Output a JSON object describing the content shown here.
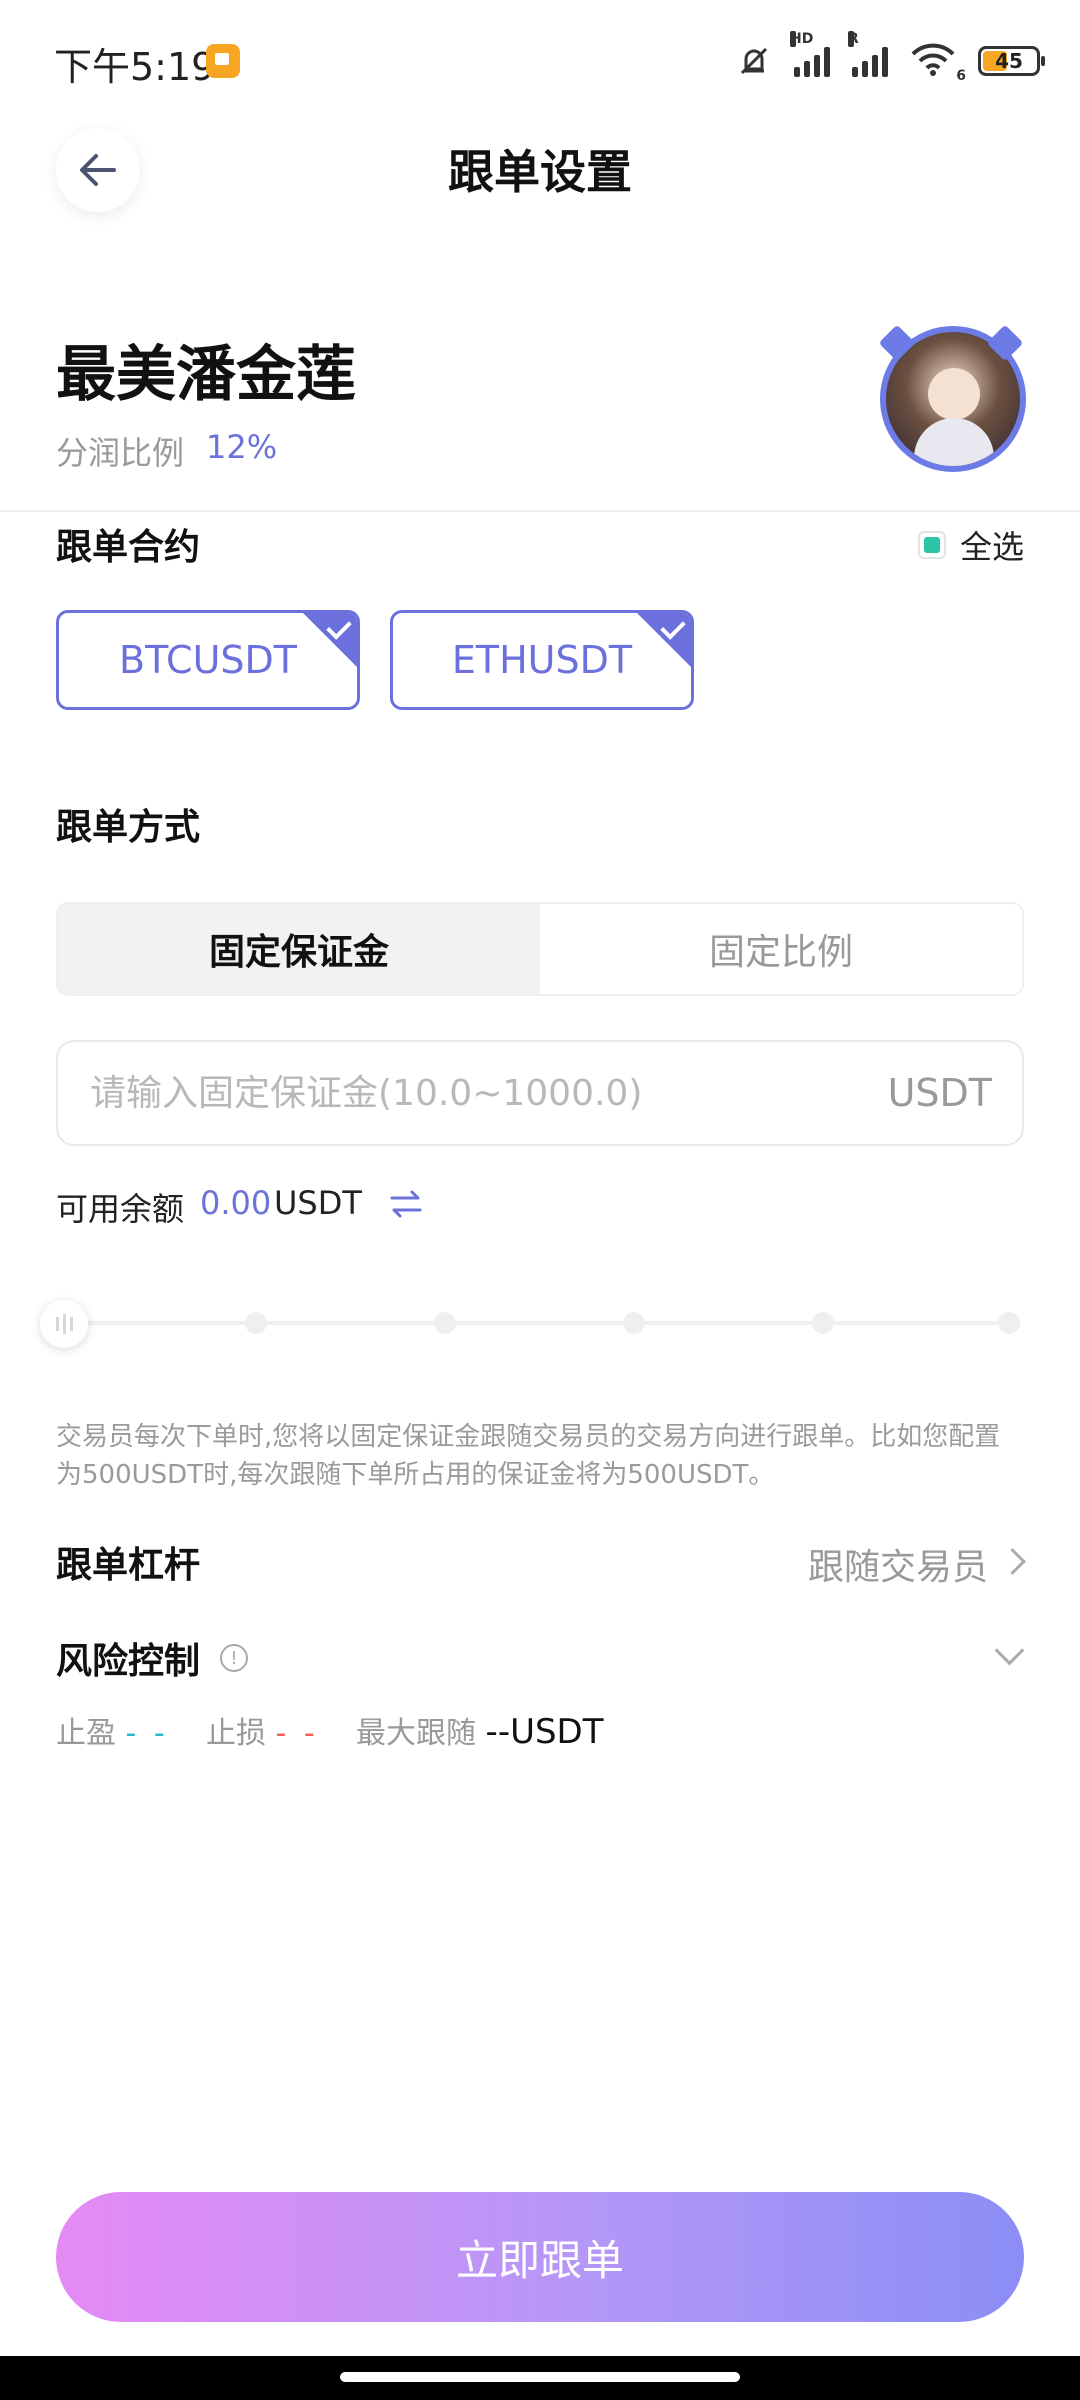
{
  "status_bar": {
    "time": "下午5:19",
    "signal1_tag": "HD",
    "signal2_tag": "R",
    "wifi_tag": "6",
    "battery": "45"
  },
  "header": {
    "title": "跟单设置"
  },
  "trader": {
    "name": "最美潘金莲",
    "profit_share_label": "分润比例",
    "profit_share_value": "12%"
  },
  "contracts": {
    "title": "跟单合约",
    "select_all_label": "全选",
    "items": [
      {
        "label": "BTCUSDT",
        "selected": true
      },
      {
        "label": "ETHUSDT",
        "selected": true
      }
    ]
  },
  "mode": {
    "title": "跟单方式",
    "tabs": [
      {
        "label": "固定保证金",
        "active": true
      },
      {
        "label": "固定比例",
        "active": false
      }
    ],
    "input_placeholder": "请输入固定保证金(10.0~1000.0)",
    "input_unit": "USDT",
    "available_label": "可用余额",
    "available_value": "0.00",
    "available_unit": "USDT",
    "slider_value_percent": 0,
    "note": "交易员每次下单时,您将以固定保证金跟随交易员的交易方向进行跟单。比如您配置为500USDT时,每次跟随下单所占用的保证金将为500USDT。"
  },
  "leverage": {
    "label": "跟单杠杆",
    "value": "跟随交易员"
  },
  "risk": {
    "label": "风险控制",
    "take_profit_label": "止盈",
    "take_profit_value": "- -",
    "stop_loss_label": "止损",
    "stop_loss_value": "- -",
    "max_follow_label": "最大跟随",
    "max_follow_value": "--USDT"
  },
  "cta": {
    "label": "立即跟单"
  },
  "colors": {
    "accent": "#6c70dd",
    "check_green": "#2ec4a6",
    "tp_cyan": "#27b8c6",
    "sl_red": "#f25c5c"
  }
}
